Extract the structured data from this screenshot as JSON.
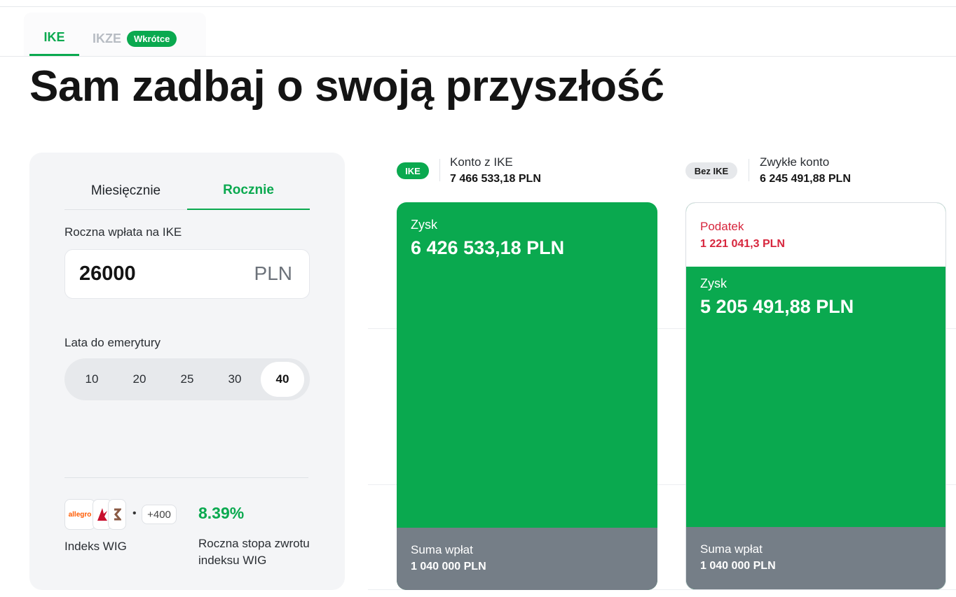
{
  "product_tabs": [
    {
      "label": "IKE",
      "active": true
    },
    {
      "label": "IKZE",
      "active": false,
      "badge": "Wkrótce"
    }
  ],
  "title": "Sam zadbaj o swoją przyszłość",
  "calculator": {
    "period_tabs": [
      "Miesięcznie",
      "Rocznie"
    ],
    "active_period": "Rocznie",
    "contribution_label": "Roczna wpłata na IKE",
    "contribution_value": "26000",
    "currency": "PLN",
    "years_label": "Lata do emerytury",
    "years_options": [
      "10",
      "20",
      "25",
      "30",
      "40"
    ],
    "years_selected": "40",
    "index": {
      "logo_text": "allegro",
      "more_count": "+400",
      "dot": "•",
      "name": "Indeks WIG",
      "rate": "8.39%",
      "rate_label": "Roczna stopa zwrotu indeksu WIG"
    }
  },
  "comparison": {
    "ike": {
      "pill": "IKE",
      "title": "Konto z IKE",
      "total": "7 466 533,18 PLN",
      "gain_label": "Zysk",
      "gain_value": "6 426 533,18 PLN",
      "deposits_label": "Suma wpłat",
      "deposits_value": "1 040 000 PLN"
    },
    "without": {
      "pill": "Bez IKE",
      "title": "Zwykłe konto",
      "total": "6 245 491,88 PLN",
      "tax_label": "Podatek",
      "tax_value": "1 221 041,3 PLN",
      "gain_label": "Zysk",
      "gain_value": "5 205 491,88 PLN",
      "deposits_label": "Suma wpłat",
      "deposits_value": "1 040 000 PLN"
    }
  },
  "colors": {
    "accent": "#0aa94f",
    "deposits": "#757e87",
    "tax": "#d7263d"
  }
}
